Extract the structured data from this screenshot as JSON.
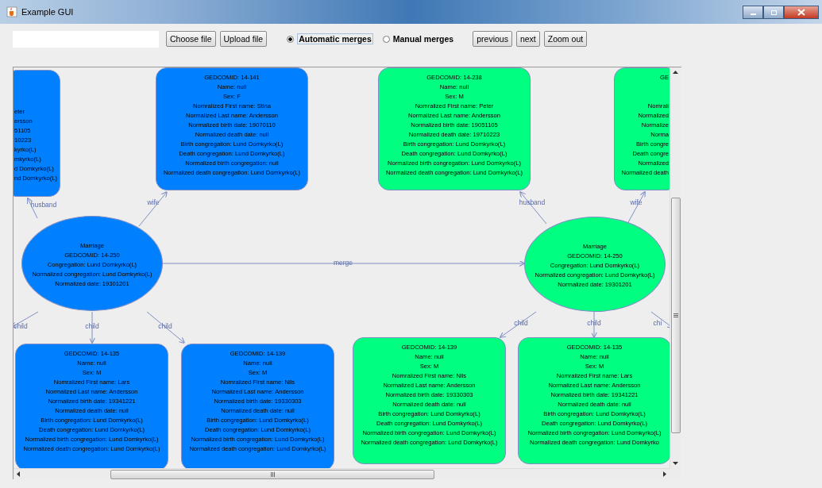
{
  "window": {
    "title": "Example GUI"
  },
  "toolbar": [
    {
      "kind": "field"
    },
    {
      "kind": "button",
      "label": "Choose file"
    },
    {
      "kind": "button",
      "label": "Upload file"
    },
    {
      "kind": "radio",
      "label": "Automatic merges",
      "selected": true
    },
    {
      "kind": "radio",
      "label": "Manual merges",
      "selected": false
    },
    {
      "kind": "button",
      "label": "previous"
    },
    {
      "kind": "button",
      "label": "next"
    },
    {
      "kind": "button",
      "label": "Zoom out"
    }
  ],
  "graph": {
    "nodes": [
      {
        "kind": "person_cut_left",
        "color": "#0080ff",
        "lines": [
          "eter",
          "ersson",
          "51105",
          "10223",
          "kyrko(L)",
          "mkyrko(L)",
          "d Domkyrko(L)",
          "nd Domkyrko(L)"
        ]
      },
      {
        "kind": "person",
        "color": "#0080ff",
        "lines": [
          "GEDCOMID: 14-141",
          "Name: null",
          "Sex: F",
          "Nomralized First name: Stina",
          "Normalized Last name: Andersson",
          "Normalized birth date: 19070110",
          "Normalized death date: null",
          "Birth congregation: Lund Domkyrko(L)",
          "Death congregation: Lund Domkyrko(L)",
          "Normalized birth congregation: null",
          "Normalized death congregation: Lund Domkyrko(L)"
        ]
      },
      {
        "kind": "person",
        "color": "#00ff80",
        "lines": [
          "GEDCOMID: 14-238",
          "Name: null",
          "Sex: M",
          "Nomralized First name: Peter",
          "Normalized Last name: Andersson",
          "Normalized birth date: 19051105",
          "Normalized death date: 19710223",
          "Birth congregation: Lund Domkyrko(L)",
          "Death congregation: Lund Domkyrko(L)",
          "Normalized birth congregation: Lund Domkyrko(L)",
          "Normalized death congregation: Lund Domkyrko(L)"
        ]
      },
      {
        "kind": "person_cut_right",
        "color": "#00ff80",
        "lines": [
          "GE",
          "Nomrali",
          "Normalized",
          "Normalize",
          "Norma",
          "Birth congre",
          "Death congre",
          "Normalized",
          "Normalized death"
        ]
      },
      {
        "kind": "marriage",
        "color": "#0080ff",
        "lines": [
          "Marriage",
          "GEDCOMID: 14-250",
          "Congregation: Lund Domkyrko(L)",
          "Normalized congregation: Lund Domkyrko(L)",
          "Normalized date: 19301201"
        ]
      },
      {
        "kind": "marriage",
        "color": "#00ff80",
        "lines": [
          "Marriage",
          "GEDCOMID: 14-250",
          "Congregation: Lund Domkyrko(L)",
          "Normalized congregation: Lund Domkyrko(L)",
          "Normalized date: 19301201"
        ]
      },
      {
        "kind": "person",
        "color": "#0080ff",
        "lines": [
          "GEDCOMID: 14-135",
          "Name: null",
          "Sex: M",
          "Nomralized First name: Lars",
          "Normalized Last name: Andersson",
          "Normalized birth date: 19341221",
          "Normalized death date: null",
          "Birth congregation: Lund Domkyrko(L)",
          "Death congregation: Lund Domkyrko(L)",
          "Normalized birth congregation: Lund Domkyrko(L)",
          "Normalized death congregation: Lund Domkyrko(L)"
        ]
      },
      {
        "kind": "person",
        "color": "#0080ff",
        "lines": [
          "GEDCOMID: 14-139",
          "Name: null",
          "Sex: M",
          "Nomralized First name: Nils",
          "Normalized Last name: Andersson",
          "Normalized birth date: 19330303",
          "Normalized death date: null",
          "Birth congregation: Lund Domkyrko(L)",
          "Death congregation: Lund Domkyrko(L)",
          "Normalized birth congregation: Lund Domkyrko(L)",
          "Normalized death congregation: Lund Domkyrko(L)"
        ]
      },
      {
        "kind": "person",
        "color": "#00ff80",
        "lines": [
          "GEDCOMID: 14-139",
          "Name: null",
          "Sex: M",
          "Nomralized First name: Nils",
          "Normalized Last name: Andersson",
          "Normalized birth date: 19330303",
          "Normalized death date: null",
          "Birth congregation: Lund Domkyrko(L)",
          "Death congregation: Lund Domkyrko(L)",
          "Normalized birth congregation: Lund Domkyrko(L)",
          "Normalized death congregation: Lund Domkyrko(L)"
        ]
      },
      {
        "kind": "person",
        "color": "#00ff80",
        "lines": [
          "GEDCOMID: 14-135",
          "Name: null",
          "Sex: M",
          "Nomralized First name: Lars",
          "Normalized Last name: Andersson",
          "Normalized birth date: 19341221",
          "Normalized death date: null",
          "Birth congregation: Lund Domkyrko(L)",
          "Death congregation: Lund Domkyrko(L)",
          "Normalized birth congregation: Lund Domkyrko(L)",
          "Normalized death congregation: Lund Domkyrko"
        ]
      }
    ],
    "edges": [
      {
        "label": "husband"
      },
      {
        "label": "wife"
      },
      {
        "label": "merge"
      },
      {
        "label": "child"
      },
      {
        "label": "child"
      },
      {
        "label": "child"
      },
      {
        "label": "husband"
      },
      {
        "label": "wife"
      },
      {
        "label": "child"
      },
      {
        "label": "child"
      },
      {
        "label": "chi"
      }
    ]
  }
}
